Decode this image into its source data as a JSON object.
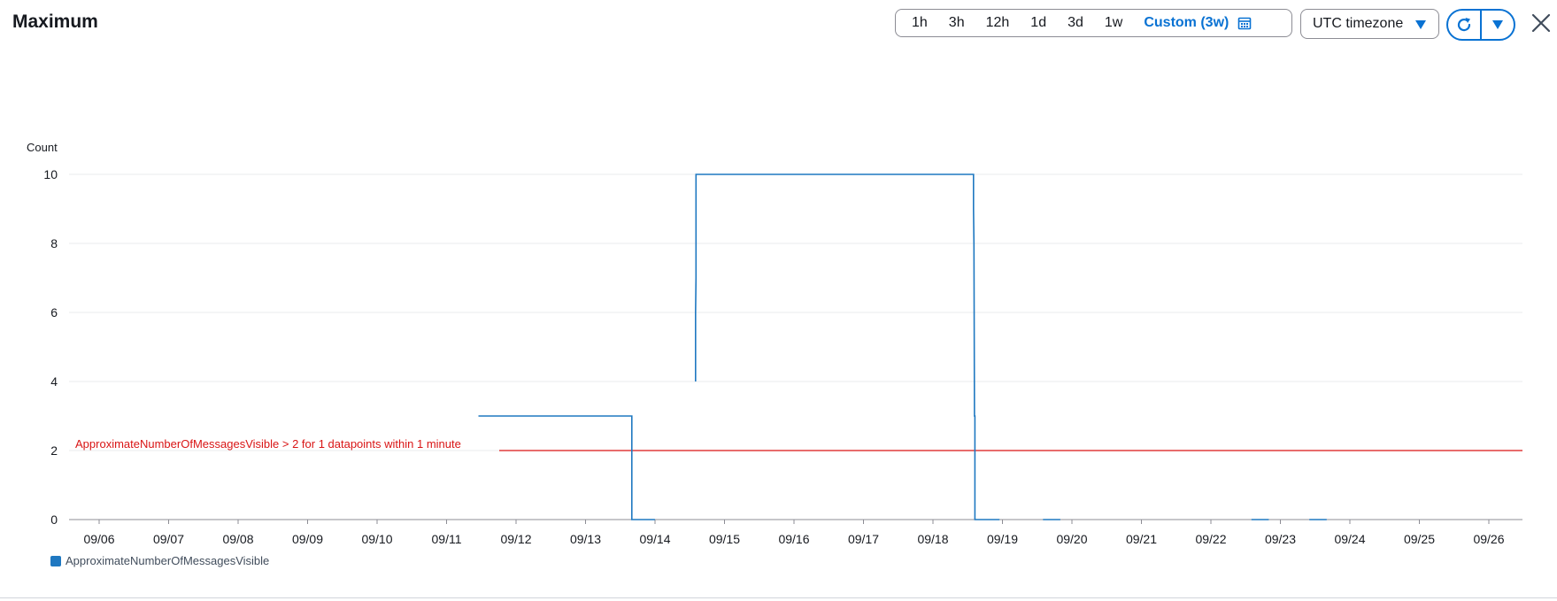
{
  "header": {
    "title": "Maximum",
    "ranges": [
      {
        "label": "1h",
        "active": false
      },
      {
        "label": "3h",
        "active": false
      },
      {
        "label": "12h",
        "active": false
      },
      {
        "label": "1d",
        "active": false
      },
      {
        "label": "3d",
        "active": false
      },
      {
        "label": "1w",
        "active": false
      },
      {
        "label": "Custom (3w)",
        "active": true
      }
    ],
    "timezone": "UTC timezone"
  },
  "colors": {
    "accent": "#0972d3",
    "series": "#1f78c1",
    "threshold": "#d91515",
    "grid": "#e9ebed",
    "axis": "#8c8c94"
  },
  "chart_data": {
    "type": "line",
    "ylabel": "Count",
    "ylim": [
      0,
      10
    ],
    "yticks": [
      0,
      2,
      4,
      6,
      8,
      10
    ],
    "xticks": [
      "09/06",
      "09/07",
      "09/08",
      "09/09",
      "09/10",
      "09/11",
      "09/12",
      "09/13",
      "09/14",
      "09/15",
      "09/16",
      "09/17",
      "09/18",
      "09/19",
      "09/20",
      "09/21",
      "09/22",
      "09/23",
      "09/24",
      "09/25",
      "09/26"
    ],
    "threshold": {
      "value": 2,
      "label": "ApproximateNumberOfMessagesVisible > 2 for 1 datapoints within 1 minute"
    },
    "series": [
      {
        "name": "ApproximateNumberOfMessagesVisible",
        "segments": [
          [
            [
              "09/11 11:00",
              3
            ],
            [
              "09/13 16:00",
              3
            ],
            [
              "09/13 16:00",
              0
            ],
            [
              "09/13 23:59",
              0
            ]
          ],
          [
            [
              "09/14 14:00",
              4
            ],
            [
              "09/14 14:00",
              6
            ],
            [
              "09/14 14:10",
              7
            ],
            [
              "09/14 14:10",
              10
            ],
            [
              "09/18 14:00",
              10
            ],
            [
              "09/18 14:00",
              9
            ],
            [
              "09/18 14:10",
              8
            ],
            [
              "09/18 14:20",
              3
            ],
            [
              "09/18 14:30",
              3
            ],
            [
              "09/18 14:30",
              0
            ],
            [
              "09/18 23:00",
              0
            ]
          ],
          [
            [
              "09/19 14:00",
              0
            ],
            [
              "09/19 20:00",
              0
            ]
          ],
          [
            [
              "09/22 14:00",
              0
            ],
            [
              "09/22 20:00",
              0
            ]
          ],
          [
            [
              "09/23 10:00",
              0
            ],
            [
              "09/23 16:00",
              0
            ]
          ]
        ]
      }
    ]
  }
}
